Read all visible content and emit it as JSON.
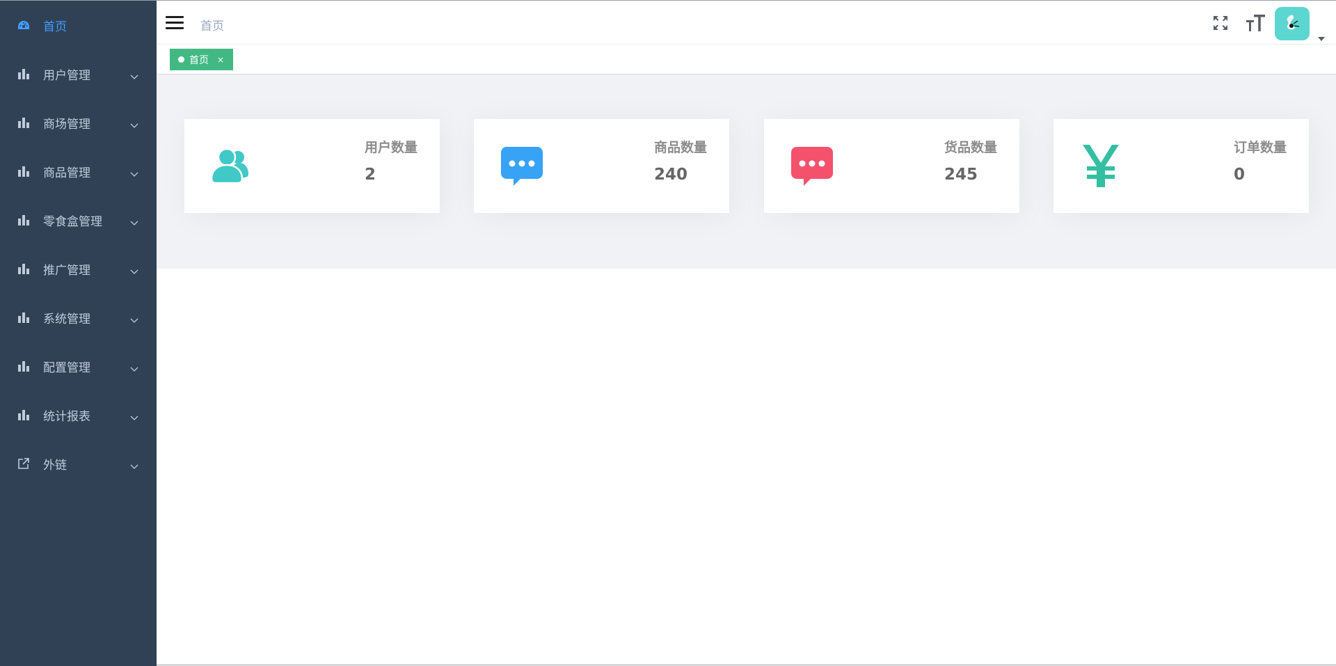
{
  "sidebar": {
    "items": [
      {
        "label": "首页",
        "icon": "dashboard-icon",
        "active": true
      },
      {
        "label": "用户管理",
        "icon": "chart-icon"
      },
      {
        "label": "商场管理",
        "icon": "chart-icon"
      },
      {
        "label": "商品管理",
        "icon": "chart-icon"
      },
      {
        "label": "零食盒管理",
        "icon": "chart-icon"
      },
      {
        "label": "推广管理",
        "icon": "chart-icon"
      },
      {
        "label": "系统管理",
        "icon": "chart-icon"
      },
      {
        "label": "配置管理",
        "icon": "chart-icon"
      },
      {
        "label": "统计报表",
        "icon": "chart-icon"
      },
      {
        "label": "外链",
        "icon": "external-link-icon"
      }
    ]
  },
  "navbar": {
    "breadcrumb": "首页"
  },
  "tags": {
    "active_tag": "首页",
    "close_glyph": "×"
  },
  "cards": [
    {
      "label": "用户数量",
      "value": "2",
      "icon": "users-icon",
      "color": "#40c9c6"
    },
    {
      "label": "商品数量",
      "value": "240",
      "icon": "message-icon",
      "color": "#36a3f7"
    },
    {
      "label": "货品数量",
      "value": "245",
      "icon": "message-icon",
      "color": "#f4516c"
    },
    {
      "label": "订单数量",
      "value": "0",
      "icon": "yen-icon",
      "color": "#34bfa3"
    }
  ],
  "colors": {
    "sidebar_bg": "#304156",
    "sidebar_text": "#bfcbd9",
    "active": "#409eff",
    "tag": "#42b983",
    "dashboard_bg": "#f0f2f5"
  }
}
